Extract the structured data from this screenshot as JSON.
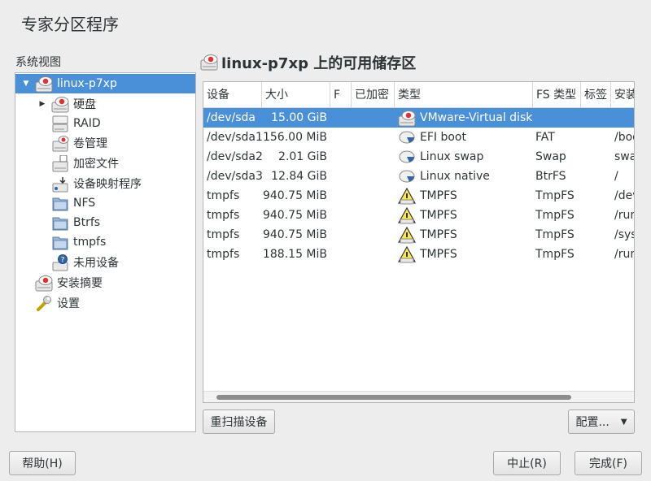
{
  "app": {
    "title": "专家分区程序"
  },
  "sidebar": {
    "heading": "系统视图",
    "items": [
      {
        "label": "linux-p7xp",
        "icon": "harddisk-red-icon",
        "expander": "▼",
        "selected": true
      },
      {
        "label": "硬盘",
        "icon": "harddisk-red-icon",
        "expander": "▶"
      },
      {
        "label": "RAID",
        "icon": "raid-icon"
      },
      {
        "label": "卷管理",
        "icon": "volume-manager-icon"
      },
      {
        "label": "加密文件",
        "icon": "encrypted-file-icon"
      },
      {
        "label": "设备映射程序",
        "icon": "device-mapper-icon"
      },
      {
        "label": "NFS",
        "icon": "folder-icon"
      },
      {
        "label": "Btrfs",
        "icon": "folder-icon"
      },
      {
        "label": "tmpfs",
        "icon": "folder-icon"
      },
      {
        "label": "未用设备",
        "icon": "unused-device-icon"
      },
      {
        "label": "安装摘要",
        "icon": "harddisk-red-icon"
      },
      {
        "label": "设置",
        "icon": "wrench-icon"
      }
    ]
  },
  "main": {
    "title": "linux-p7xp 上的可用储存区",
    "columns": [
      "设备",
      "大小",
      "F",
      "已加密",
      "类型",
      "FS 类型",
      "标签",
      "安装"
    ],
    "rows": [
      {
        "device": "/dev/sda",
        "size": "15.00 GiB",
        "type": "VMware-Virtual disk",
        "type_icon": "harddisk-red-icon",
        "fs": "",
        "label": "",
        "mount": "",
        "selected": true
      },
      {
        "device": "/dev/sda1",
        "size": "156.00 MiB",
        "type": "EFI boot",
        "type_icon": "partition-icon",
        "fs": "FAT",
        "label": "",
        "mount": "/boo"
      },
      {
        "device": "/dev/sda2",
        "size": "2.01 GiB",
        "type": "Linux swap",
        "type_icon": "partition-icon",
        "fs": "Swap",
        "label": "",
        "mount": "swa"
      },
      {
        "device": "/dev/sda3",
        "size": "12.84 GiB",
        "type": "Linux native",
        "type_icon": "partition-icon",
        "fs": "BtrFS",
        "label": "",
        "mount": "/"
      },
      {
        "device": "tmpfs",
        "size": "940.75 MiB",
        "type": "TMPFS",
        "type_icon": "tmpfs-warning-icon",
        "fs": "TmpFS",
        "label": "",
        "mount": "/dev"
      },
      {
        "device": "tmpfs",
        "size": "940.75 MiB",
        "type": "TMPFS",
        "type_icon": "tmpfs-warning-icon",
        "fs": "TmpFS",
        "label": "",
        "mount": "/run"
      },
      {
        "device": "tmpfs",
        "size": "940.75 MiB",
        "type": "TMPFS",
        "type_icon": "tmpfs-warning-icon",
        "fs": "TmpFS",
        "label": "",
        "mount": "/sys"
      },
      {
        "device": "tmpfs",
        "size": "188.15 MiB",
        "type": "TMPFS",
        "type_icon": "tmpfs-warning-icon",
        "fs": "TmpFS",
        "label": "",
        "mount": "/run"
      }
    ],
    "rescan_label": "重扫描设备",
    "configure_label": "配置...",
    "configure_arrow": "▼"
  },
  "footer": {
    "help_label": "帮助(H)",
    "abort_label": "中止(R)",
    "finish_label": "完成(F)"
  },
  "colors": {
    "selection": "#4a90d9",
    "window_bg": "#ededed"
  }
}
